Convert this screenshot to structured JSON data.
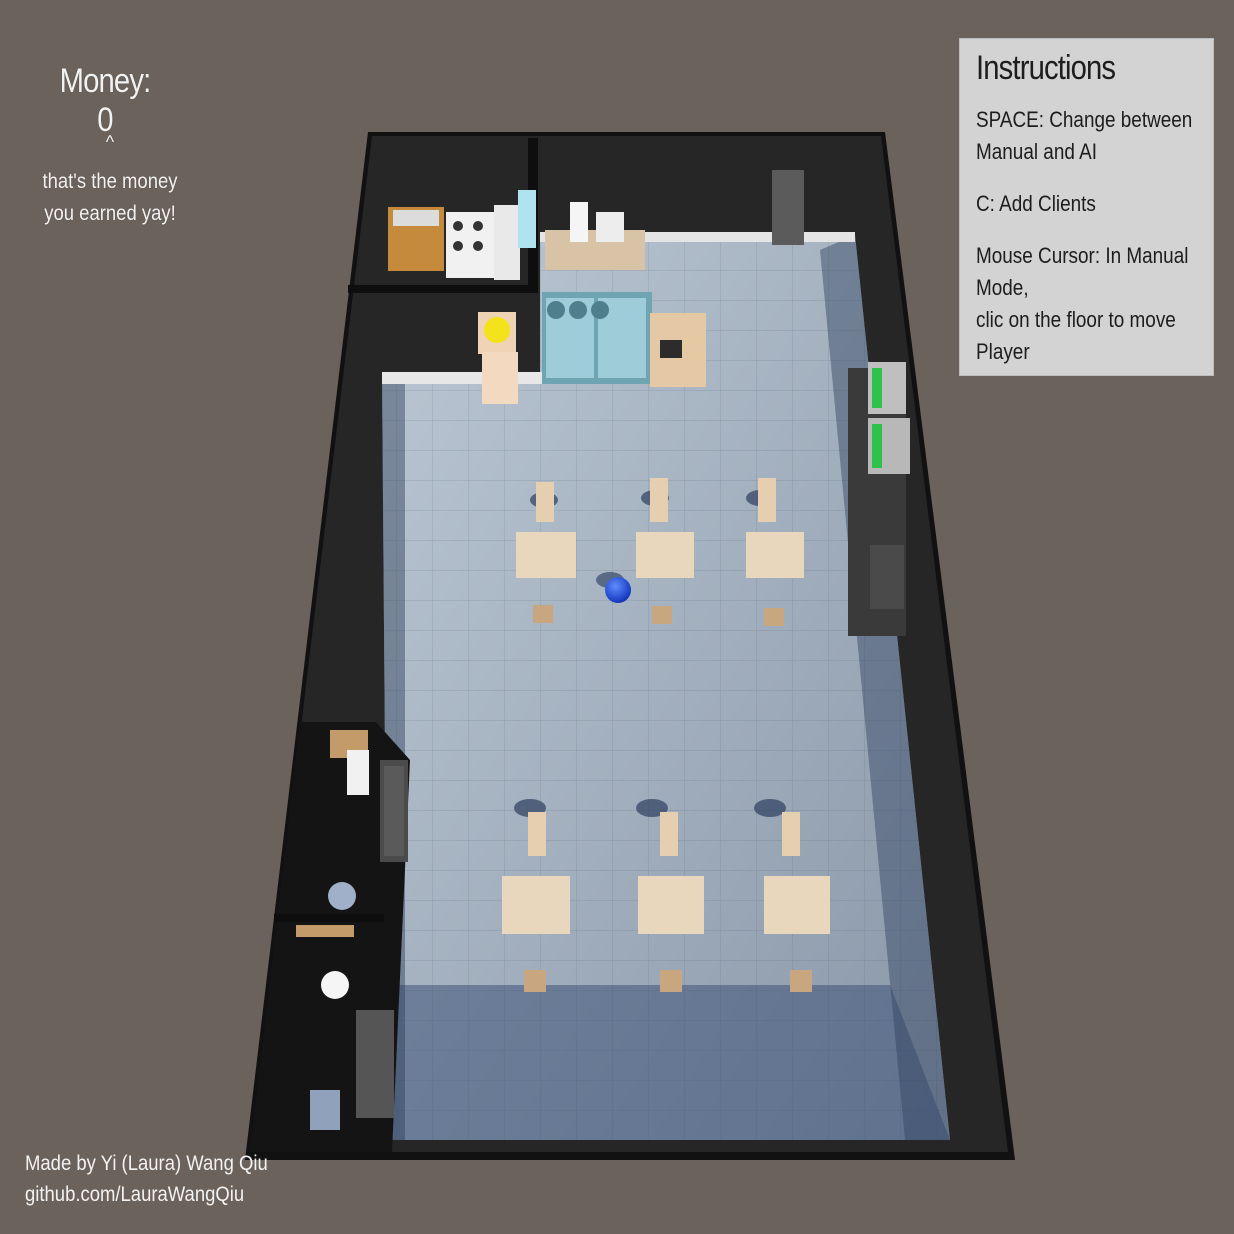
{
  "hud": {
    "money_label": "Money: 0",
    "money_pointer": "^",
    "money_note_line1": "that's the money",
    "money_note_line2": "you earned yay!"
  },
  "instructions": {
    "title": "Instructions",
    "items": [
      {
        "line1": "SPACE: Change between",
        "line2": "Manual and AI"
      },
      {
        "line1": "C: Add Clients",
        "line2": ""
      },
      {
        "line1": "Mouse Cursor: In Manual Mode,",
        "line2": "clic on the floor to move Player"
      }
    ]
  },
  "credits": {
    "author": "Made by Yi (Laura) Wang Qiu",
    "link": "github.com/LauraWangQiu"
  },
  "colors": {
    "background": "#6b625b",
    "floor": "#b7c4d1",
    "wall": "#1c1c1c",
    "player": "#1f4fe0",
    "table": "#e8d6bd"
  }
}
